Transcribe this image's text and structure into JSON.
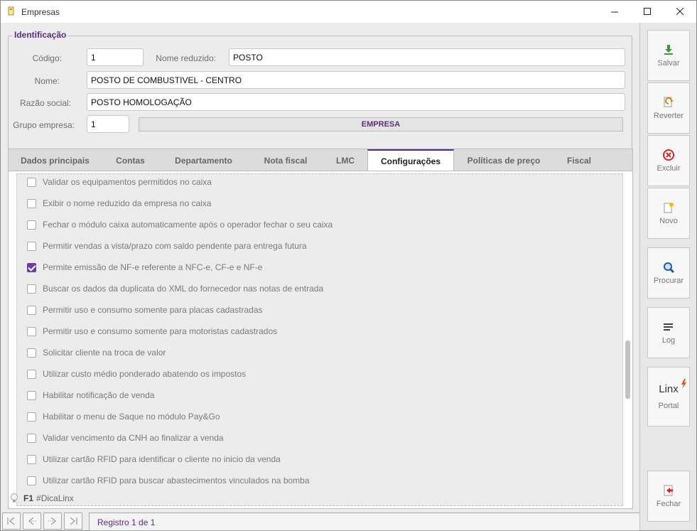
{
  "window": {
    "title": "Empresas"
  },
  "identificacao": {
    "title": "Identificação",
    "codigo_label": "Código:",
    "codigo_value": "1",
    "nome_reduzido_label": "Nome reduzido:",
    "nome_reduzido_value": "POSTO",
    "nome_label": "Nome:",
    "nome_value": "POSTO DE COMBUSTIVEL - CENTRO",
    "razao_label": "Razão social:",
    "razao_value": "POSTO HOMOLOGAÇÃO",
    "grupo_label": "Grupo empresa:",
    "grupo_value": "1",
    "grupo_name": "EMPRESA"
  },
  "tabs": [
    "Dados principais",
    "Contas",
    "Departamento",
    "Nota fiscal",
    "LMC",
    "Configurações",
    "Políticas de preço",
    "Fiscal"
  ],
  "active_tab": "Configurações",
  "options": [
    {
      "label": "Validar os equipamentos permitidos no caixa",
      "checked": false
    },
    {
      "label": "Exibir o nome reduzido da empresa no caixa",
      "checked": false
    },
    {
      "label": "Fechar o módulo caixa automaticamente após o operador fechar o seu caixa",
      "checked": false
    },
    {
      "label": "Permitir vendas a vista/prazo com saldo pendente para entrega futura",
      "checked": false
    },
    {
      "label": "Permite emissão de NF-e referente a NFC-e, CF-e e NF-e",
      "checked": true
    },
    {
      "label": "Buscar os dados da duplicata do XML do fornecedor nas notas de entrada",
      "checked": false
    },
    {
      "label": "Permitir uso e consumo somente para placas cadastradas",
      "checked": false
    },
    {
      "label": "Permitir uso e consumo somente para motoristas cadastrados",
      "checked": false
    },
    {
      "label": "Solicitar cliente na troca de valor",
      "checked": false
    },
    {
      "label": "Utilizar custo médio ponderado abatendo os impostos",
      "checked": false
    },
    {
      "label": "Habilitar notificação de venda",
      "checked": false
    },
    {
      "label": "Habilitar o menu de Saque no módulo Pay&Go",
      "checked": false
    },
    {
      "label": "Validar vencimento da CNH ao finalizar a venda",
      "checked": false
    },
    {
      "label": "Utilizar cartão RFID para identificar o cliente no inicio da venda",
      "checked": false
    },
    {
      "label": "Utilizar cartão RFID para buscar abastecimentos vinculados na bomba",
      "checked": false
    }
  ],
  "tip": {
    "key": "F1",
    "text": "#DicaLinx"
  },
  "record_status": "Registro 1 de 1",
  "toolbar": {
    "salvar": "Salvar",
    "reverter": "Reverter",
    "excluir": "Excluir",
    "novo": "Novo",
    "procurar": "Procurar",
    "log": "Log",
    "portal_logo": "Linx",
    "portal": "Portal",
    "fechar": "Fechar"
  },
  "colors": {
    "accent": "#5b2d82",
    "check": "#6b3fa0"
  }
}
